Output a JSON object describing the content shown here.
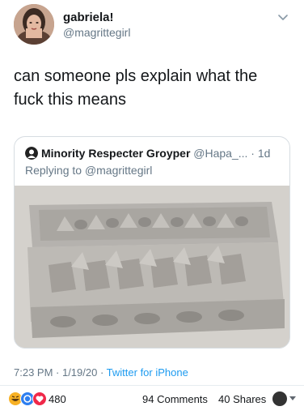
{
  "tweet": {
    "display_name": "gabriela!",
    "handle": "@magrittegirl",
    "text": "can someone pls explain what the fuck this means",
    "timestamp": "7:23 PM · 1/19/20 · ",
    "source": "Twitter for iPhone"
  },
  "quoted": {
    "display_name": "Minority Respecter Groyper",
    "handle": "@Hapa_...",
    "time": " · 1d",
    "reply_prefix": "Replying to ",
    "reply_to": "@magrittegirl"
  },
  "facebook": {
    "reaction_count": "480",
    "comments": "94 Comments",
    "shares": "40 Shares"
  },
  "icons": [
    "chevron-down-icon",
    "haha-reaction-icon",
    "wow-reaction-icon",
    "love-reaction-icon",
    "profile-mini-icon",
    "caret-down-icon"
  ],
  "colors": {
    "link": "#1d9bf0",
    "muted": "#657786",
    "text": "#14171a",
    "border": "#d6dce1"
  }
}
